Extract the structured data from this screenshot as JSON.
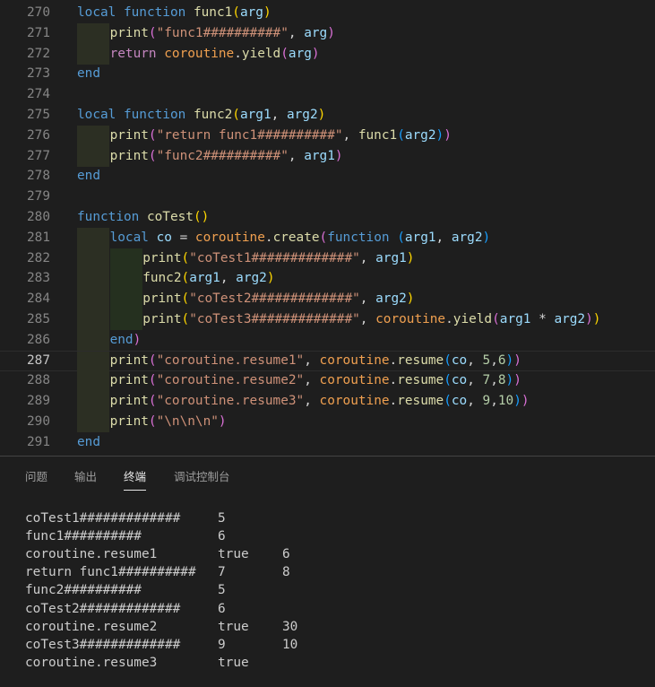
{
  "editor": {
    "lines": [
      {
        "n": "270",
        "parts": [
          [
            "tk-kw",
            "local "
          ],
          [
            "tk-kw",
            "function "
          ],
          [
            "tk-fn",
            "func1"
          ],
          [
            "tk-p1",
            "("
          ],
          [
            "tk-var",
            "arg"
          ],
          [
            "tk-p1",
            ")"
          ]
        ]
      },
      {
        "n": "271",
        "indent": 1,
        "parts": [
          [
            "tk-fn",
            "print"
          ],
          [
            "tk-p2",
            "("
          ],
          [
            "tk-str",
            "\"func1##########\""
          ],
          [
            "tk-plain",
            ", "
          ],
          [
            "tk-var",
            "arg"
          ],
          [
            "tk-p2",
            ")"
          ]
        ]
      },
      {
        "n": "272",
        "indent": 1,
        "parts": [
          [
            "tk-kwp",
            "return "
          ],
          [
            "tk-ns",
            "coroutine"
          ],
          [
            "tk-plain",
            "."
          ],
          [
            "tk-fn",
            "yield"
          ],
          [
            "tk-p2",
            "("
          ],
          [
            "tk-var",
            "arg"
          ],
          [
            "tk-p2",
            ")"
          ]
        ]
      },
      {
        "n": "273",
        "parts": [
          [
            "tk-kw",
            "end"
          ]
        ]
      },
      {
        "n": "274",
        "parts": []
      },
      {
        "n": "275",
        "parts": [
          [
            "tk-kw",
            "local "
          ],
          [
            "tk-kw",
            "function "
          ],
          [
            "tk-fn",
            "func2"
          ],
          [
            "tk-p1",
            "("
          ],
          [
            "tk-var",
            "arg1"
          ],
          [
            "tk-plain",
            ", "
          ],
          [
            "tk-var",
            "arg2"
          ],
          [
            "tk-p1",
            ")"
          ]
        ]
      },
      {
        "n": "276",
        "indent": 1,
        "parts": [
          [
            "tk-fn",
            "print"
          ],
          [
            "tk-p2",
            "("
          ],
          [
            "tk-str",
            "\"return func1##########\""
          ],
          [
            "tk-plain",
            ", "
          ],
          [
            "tk-fn",
            "func1"
          ],
          [
            "tk-p3",
            "("
          ],
          [
            "tk-var",
            "arg2"
          ],
          [
            "tk-p3",
            ")"
          ],
          [
            "tk-p2",
            ")"
          ]
        ]
      },
      {
        "n": "277",
        "indent": 1,
        "parts": [
          [
            "tk-fn",
            "print"
          ],
          [
            "tk-p2",
            "("
          ],
          [
            "tk-str",
            "\"func2##########\""
          ],
          [
            "tk-plain",
            ", "
          ],
          [
            "tk-var",
            "arg1"
          ],
          [
            "tk-p2",
            ")"
          ]
        ]
      },
      {
        "n": "278",
        "parts": [
          [
            "tk-kw",
            "end"
          ]
        ]
      },
      {
        "n": "279",
        "parts": []
      },
      {
        "n": "280",
        "parts": [
          [
            "tk-kw",
            "function "
          ],
          [
            "tk-fn",
            "coTest"
          ],
          [
            "tk-p1",
            "()"
          ]
        ]
      },
      {
        "n": "281",
        "indent": 1,
        "parts": [
          [
            "tk-kw",
            "local "
          ],
          [
            "tk-var",
            "co "
          ],
          [
            "tk-plain",
            "= "
          ],
          [
            "tk-ns",
            "coroutine"
          ],
          [
            "tk-plain",
            "."
          ],
          [
            "tk-fn",
            "create"
          ],
          [
            "tk-p2",
            "("
          ],
          [
            "tk-kw",
            "function "
          ],
          [
            "tk-p3",
            "("
          ],
          [
            "tk-var",
            "arg1"
          ],
          [
            "tk-plain",
            ", "
          ],
          [
            "tk-var",
            "arg2"
          ],
          [
            "tk-p3",
            ")"
          ]
        ]
      },
      {
        "n": "282",
        "indent": 2,
        "parts": [
          [
            "tk-fn",
            "print"
          ],
          [
            "tk-p1",
            "("
          ],
          [
            "tk-str",
            "\"coTest1#############\""
          ],
          [
            "tk-plain",
            ", "
          ],
          [
            "tk-var",
            "arg1"
          ],
          [
            "tk-p1",
            ")"
          ]
        ]
      },
      {
        "n": "283",
        "indent": 2,
        "parts": [
          [
            "tk-fn",
            "func2"
          ],
          [
            "tk-p1",
            "("
          ],
          [
            "tk-var",
            "arg1"
          ],
          [
            "tk-plain",
            ", "
          ],
          [
            "tk-var",
            "arg2"
          ],
          [
            "tk-p1",
            ")"
          ]
        ]
      },
      {
        "n": "284",
        "indent": 2,
        "parts": [
          [
            "tk-fn",
            "print"
          ],
          [
            "tk-p1",
            "("
          ],
          [
            "tk-str",
            "\"coTest2#############\""
          ],
          [
            "tk-plain",
            ", "
          ],
          [
            "tk-var",
            "arg2"
          ],
          [
            "tk-p1",
            ")"
          ]
        ]
      },
      {
        "n": "285",
        "indent": 2,
        "parts": [
          [
            "tk-fn",
            "print"
          ],
          [
            "tk-p1",
            "("
          ],
          [
            "tk-str",
            "\"coTest3#############\""
          ],
          [
            "tk-plain",
            ", "
          ],
          [
            "tk-ns",
            "coroutine"
          ],
          [
            "tk-plain",
            "."
          ],
          [
            "tk-fn",
            "yield"
          ],
          [
            "tk-p2",
            "("
          ],
          [
            "tk-var",
            "arg1"
          ],
          [
            "tk-plain",
            " * "
          ],
          [
            "tk-var",
            "arg2"
          ],
          [
            "tk-p2",
            ")"
          ],
          [
            "tk-p1",
            ")"
          ]
        ]
      },
      {
        "n": "286",
        "indent": 1,
        "parts": [
          [
            "tk-kw",
            "end"
          ],
          [
            "tk-p2",
            ")"
          ]
        ]
      },
      {
        "n": "287",
        "indent": 1,
        "current": true,
        "parts": [
          [
            "tk-fn",
            "print"
          ],
          [
            "tk-p2",
            "("
          ],
          [
            "tk-str",
            "\"coroutine.resume1\""
          ],
          [
            "tk-plain",
            ", "
          ],
          [
            "tk-ns",
            "coroutine"
          ],
          [
            "tk-plain",
            "."
          ],
          [
            "tk-fn",
            "resume"
          ],
          [
            "tk-p3",
            "("
          ],
          [
            "tk-var",
            "co"
          ],
          [
            "tk-plain",
            ", "
          ],
          [
            "tk-num",
            "5"
          ],
          [
            "tk-plain",
            ","
          ],
          [
            "tk-num",
            "6"
          ],
          [
            "tk-p3",
            ")"
          ],
          [
            "tk-p2",
            ")"
          ]
        ]
      },
      {
        "n": "288",
        "indent": 1,
        "parts": [
          [
            "tk-fn",
            "print"
          ],
          [
            "tk-p2",
            "("
          ],
          [
            "tk-str",
            "\"coroutine.resume2\""
          ],
          [
            "tk-plain",
            ", "
          ],
          [
            "tk-ns",
            "coroutine"
          ],
          [
            "tk-plain",
            "."
          ],
          [
            "tk-fn",
            "resume"
          ],
          [
            "tk-p3",
            "("
          ],
          [
            "tk-var",
            "co"
          ],
          [
            "tk-plain",
            ", "
          ],
          [
            "tk-num",
            "7"
          ],
          [
            "tk-plain",
            ","
          ],
          [
            "tk-num",
            "8"
          ],
          [
            "tk-p3",
            ")"
          ],
          [
            "tk-p2",
            ")"
          ]
        ]
      },
      {
        "n": "289",
        "indent": 1,
        "parts": [
          [
            "tk-fn",
            "print"
          ],
          [
            "tk-p2",
            "("
          ],
          [
            "tk-str",
            "\"coroutine.resume3\""
          ],
          [
            "tk-plain",
            ", "
          ],
          [
            "tk-ns",
            "coroutine"
          ],
          [
            "tk-plain",
            "."
          ],
          [
            "tk-fn",
            "resume"
          ],
          [
            "tk-p3",
            "("
          ],
          [
            "tk-var",
            "co"
          ],
          [
            "tk-plain",
            ", "
          ],
          [
            "tk-num",
            "9"
          ],
          [
            "tk-plain",
            ","
          ],
          [
            "tk-num",
            "10"
          ],
          [
            "tk-p3",
            ")"
          ],
          [
            "tk-p2",
            ")"
          ]
        ]
      },
      {
        "n": "290",
        "indent": 1,
        "parts": [
          [
            "tk-fn",
            "print"
          ],
          [
            "tk-p2",
            "("
          ],
          [
            "tk-str",
            "\"\\n\\n\\n\""
          ],
          [
            "tk-p2",
            ")"
          ]
        ]
      },
      {
        "n": "291",
        "parts": [
          [
            "tk-kw",
            "end"
          ]
        ]
      }
    ]
  },
  "panel": {
    "tabs": [
      {
        "label": "问题",
        "active": false
      },
      {
        "label": "输出",
        "active": false
      },
      {
        "label": "终端",
        "active": true
      },
      {
        "label": "调试控制台",
        "active": false
      }
    ]
  },
  "terminal": {
    "rows": [
      [
        "coTest1#############",
        "5",
        ""
      ],
      [
        "func1##########",
        "6",
        ""
      ],
      [
        "coroutine.resume1",
        "true",
        "6"
      ],
      [
        "return func1##########",
        "7",
        "8"
      ],
      [
        "func2##########",
        "5",
        ""
      ],
      [
        "coTest2#############",
        "6",
        ""
      ],
      [
        "coroutine.resume2",
        "true",
        "30"
      ],
      [
        "coTest3#############",
        "9",
        "10"
      ],
      [
        "coroutine.resume3",
        "true",
        ""
      ]
    ]
  },
  "colors": {
    "background": "#1e1e1e",
    "keyword": "#569cd6",
    "string": "#ce9178",
    "function": "#dcdcaa",
    "variable": "#9cdcfe",
    "number": "#b5cea8"
  }
}
